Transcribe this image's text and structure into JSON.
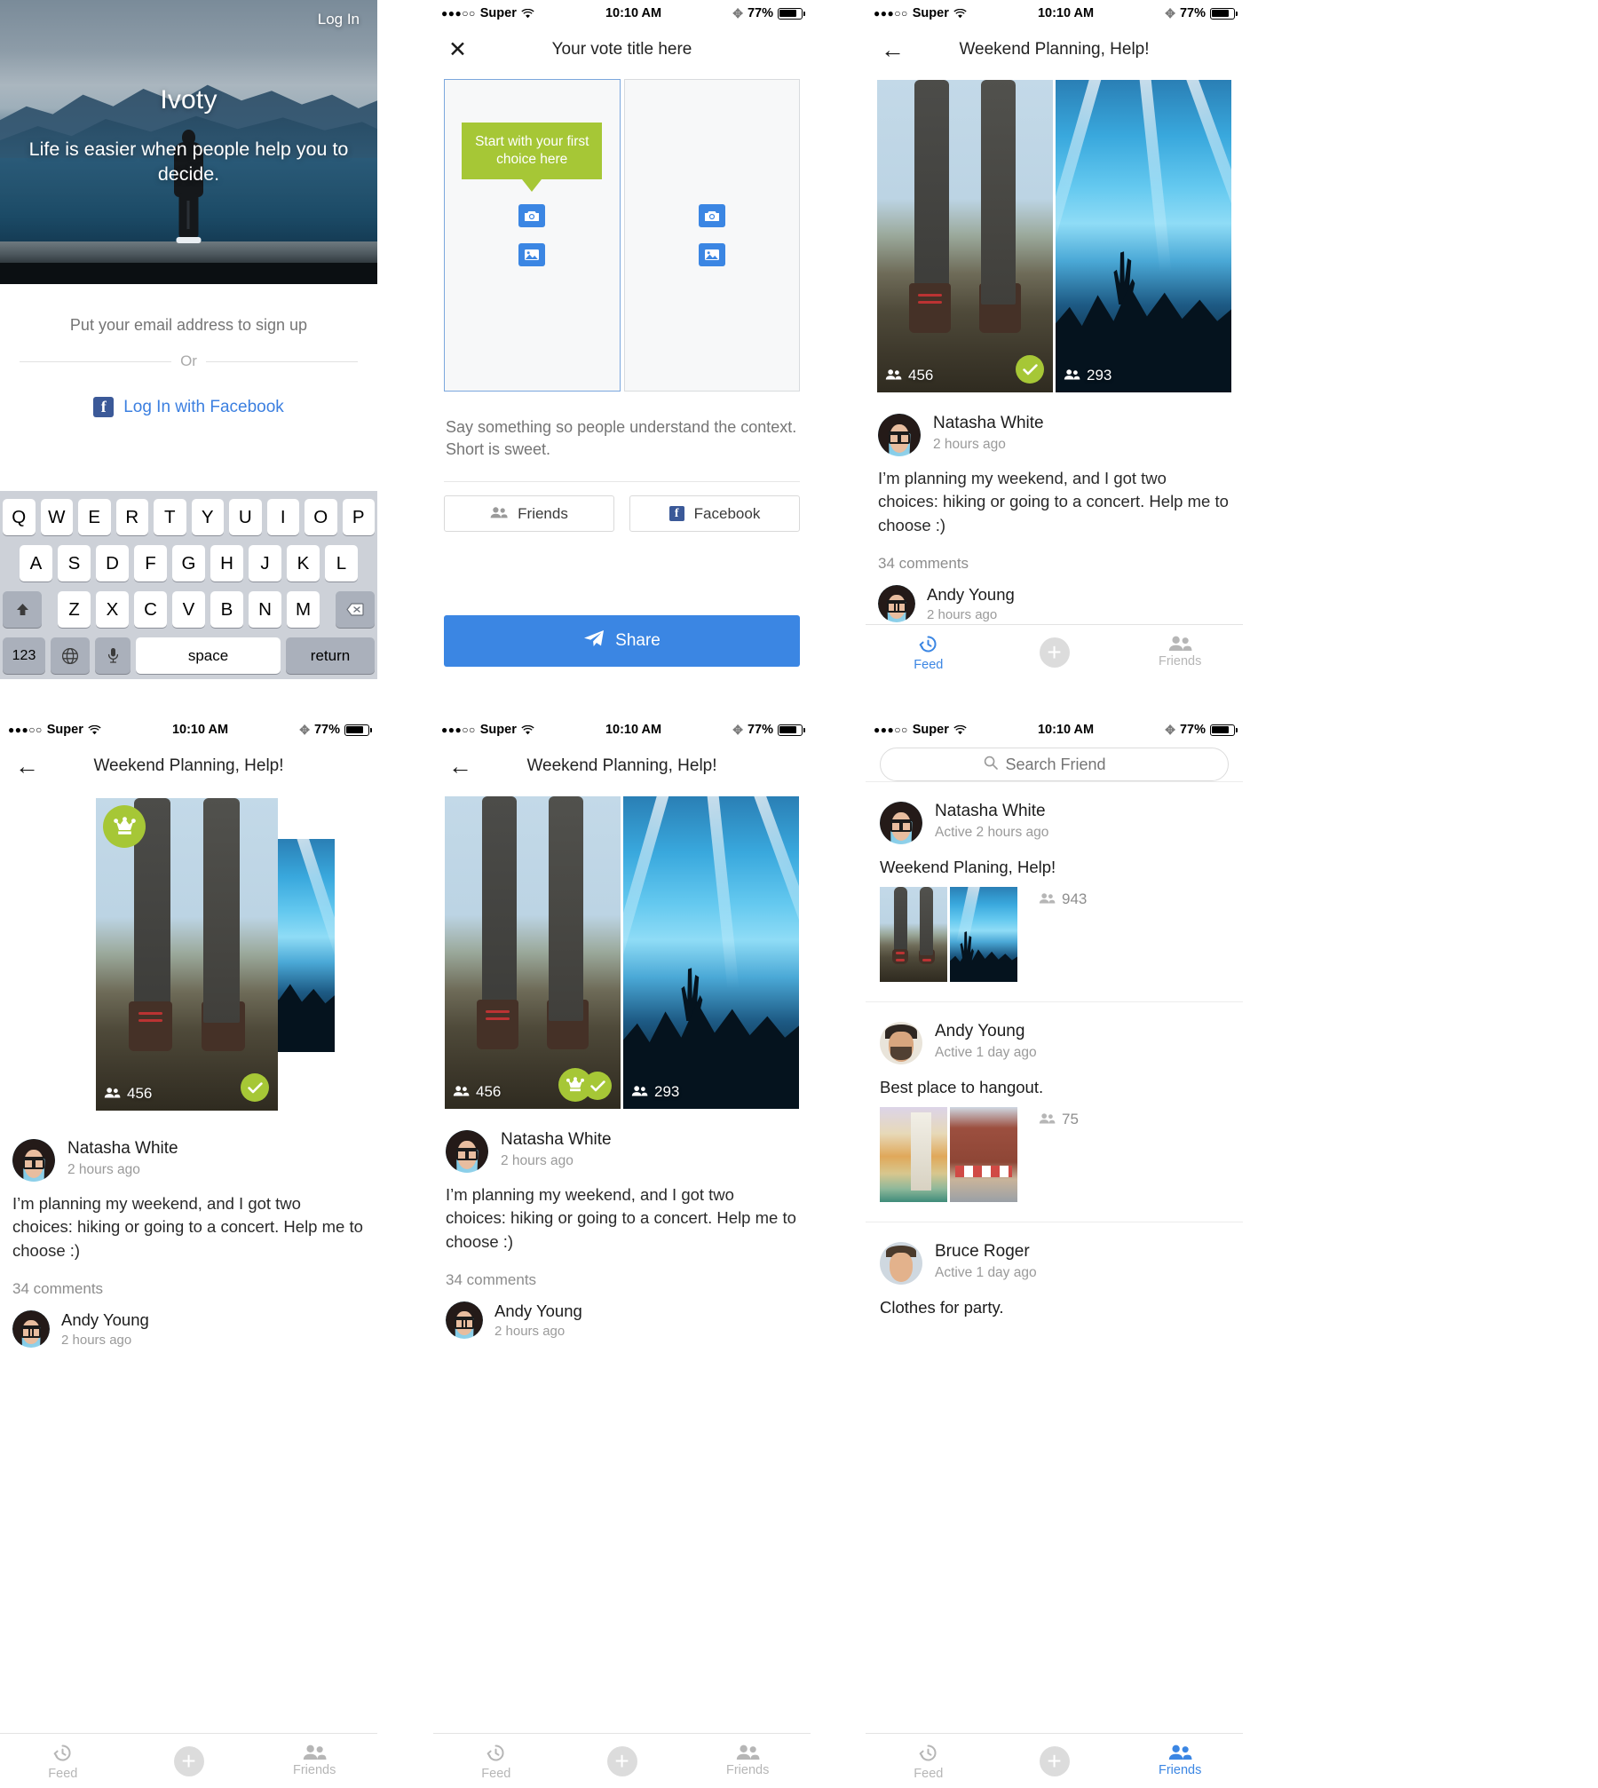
{
  "status_bar": {
    "dots": "●●●○○",
    "carrier": "Super",
    "time": "10:10 AM",
    "battery": "77%"
  },
  "panel_onboarding": {
    "login_link": "Log In",
    "app_name": "Ivoty",
    "tagline": "Life is easier when people help you to decide.",
    "email_placeholder": "Put your email address to sign up",
    "or": "Or",
    "facebook_label": "Log In with Facebook",
    "keyboard": {
      "row1": [
        "Q",
        "W",
        "E",
        "R",
        "T",
        "Y",
        "U",
        "I",
        "O",
        "P"
      ],
      "row2": [
        "A",
        "S",
        "D",
        "F",
        "G",
        "H",
        "J",
        "K",
        "L"
      ],
      "row3": [
        "Z",
        "X",
        "C",
        "V",
        "B",
        "N",
        "M"
      ],
      "numbers_key": "123",
      "space_key": "space",
      "return_key": "return"
    }
  },
  "panel_create": {
    "title": "Your vote title here",
    "close_label": "✕",
    "tip": "Start with your first choice here",
    "context_placeholder": "Say something so people understand the context. Short is sweet.",
    "friends_label": "Friends",
    "facebook_label": "Facebook",
    "share_label": "Share"
  },
  "panel_post": {
    "title": "Weekend Planning, Help!",
    "choice_a_votes": "456",
    "choice_b_votes": "293",
    "author": {
      "name": "Natasha White",
      "time": "2 hours ago",
      "text": "I’m planning my weekend, and I got two choices: hiking or going to a concert. Help me to choose :)"
    },
    "comments_count": "34 comments",
    "comment": {
      "name": "Andy Young",
      "time": "2 hours ago"
    }
  },
  "tabbar": {
    "feed": "Feed",
    "friends": "Friends"
  },
  "panel_friends": {
    "search_placeholder": "Search Friend",
    "items": [
      {
        "name": "Natasha White",
        "active": "Active 2 hours ago",
        "title": "Weekend Planing, Help!",
        "count": "943"
      },
      {
        "name": "Andy Young",
        "active": "Active 1 day ago",
        "title": "Best place to hangout.",
        "count": "75"
      },
      {
        "name": "Bruce Roger",
        "active": "Active 1 day ago",
        "title": "Clothes for party.",
        "count": ""
      }
    ]
  },
  "colors": {
    "accent_blue": "#3b86e3",
    "accent_green": "#a6c736",
    "facebook": "#3b5998"
  }
}
